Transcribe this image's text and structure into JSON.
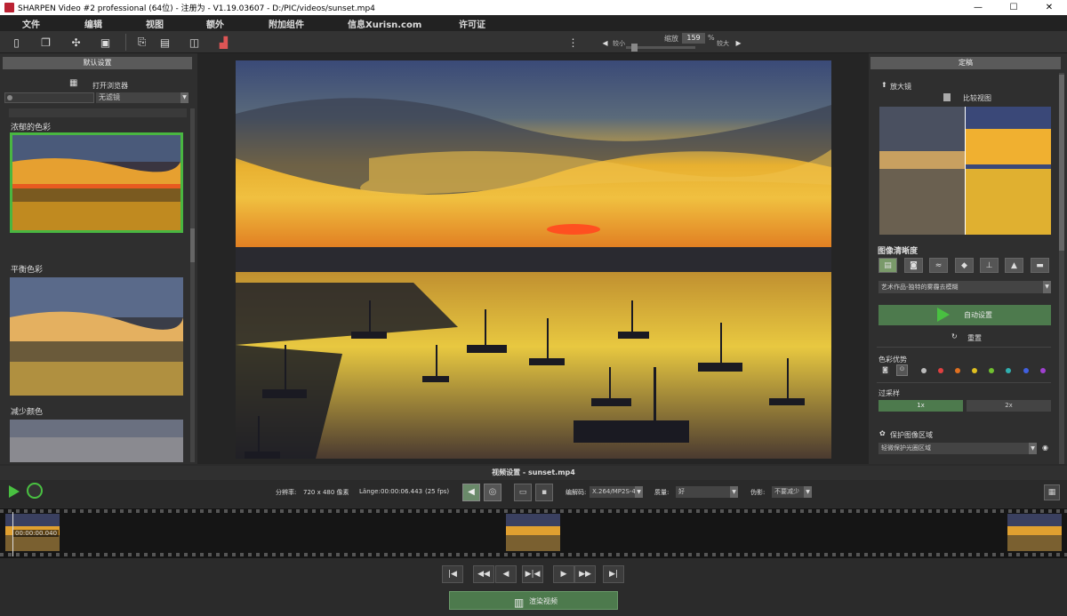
{
  "window": {
    "title": "SHARPEN Video #2 professional (64位) - 注册为 - V1.19.03607 - D:/PIC/videos/sunset.mp4",
    "minimize": "—",
    "maximize": "☐",
    "close": "✕"
  },
  "menu": [
    "文件",
    "编辑",
    "视图",
    "额外",
    "附加组件",
    "信息Xurisn.com",
    "许可证"
  ],
  "toolbar": {
    "zoom_label": "缩放",
    "zoom_value": "159",
    "zoom_unit": "%",
    "zoom_smaller": "较小",
    "zoom_larger": "较大"
  },
  "left_panel": {
    "header": "默认设置",
    "open_browser": "打开浏览器",
    "filter_select": "无滤镜",
    "presets": [
      {
        "label": "浓郁的色彩"
      },
      {
        "label": "平衡色彩"
      },
      {
        "label": "减少颜色"
      }
    ]
  },
  "right_panel": {
    "header": "定稿",
    "magnifier": "放大镜",
    "compare_view": "比较视图",
    "sharpness_title": "图像清晰度",
    "preset_select": "艺术作品-独特的雾霾去模糊",
    "auto_settings": "自动设置",
    "reset": "重置",
    "color_priority": "色彩优势",
    "oversampling": "过采样",
    "oversample_1": "1x",
    "oversample_2": "2x",
    "protect_area": "保护图像区域",
    "protect_select": "轻微保护光圈区域",
    "colors": [
      "#bbbbbb",
      "#e04040",
      "#e07020",
      "#e0c020",
      "#70c030",
      "#30b0b0",
      "#4060e0",
      "#a040d0"
    ]
  },
  "status": {
    "title": "视频设置 - sunset.mp4"
  },
  "controls": {
    "resolution_label": "分辨率:",
    "resolution_value": "720 x 480 像素",
    "length_label": "Länge:",
    "length_value": "00:00:06.443",
    "fps": "(25 fps)",
    "encoder_label": "编解码:",
    "encoder_value": "X.264/MP2S-4",
    "quality_label": "质量:",
    "quality_value": "好",
    "artifacts_label": "伪影:",
    "artifacts_value": "不要减少"
  },
  "timeline": {
    "timecode": "00:00:00.040"
  },
  "render_button": "渲染视频"
}
